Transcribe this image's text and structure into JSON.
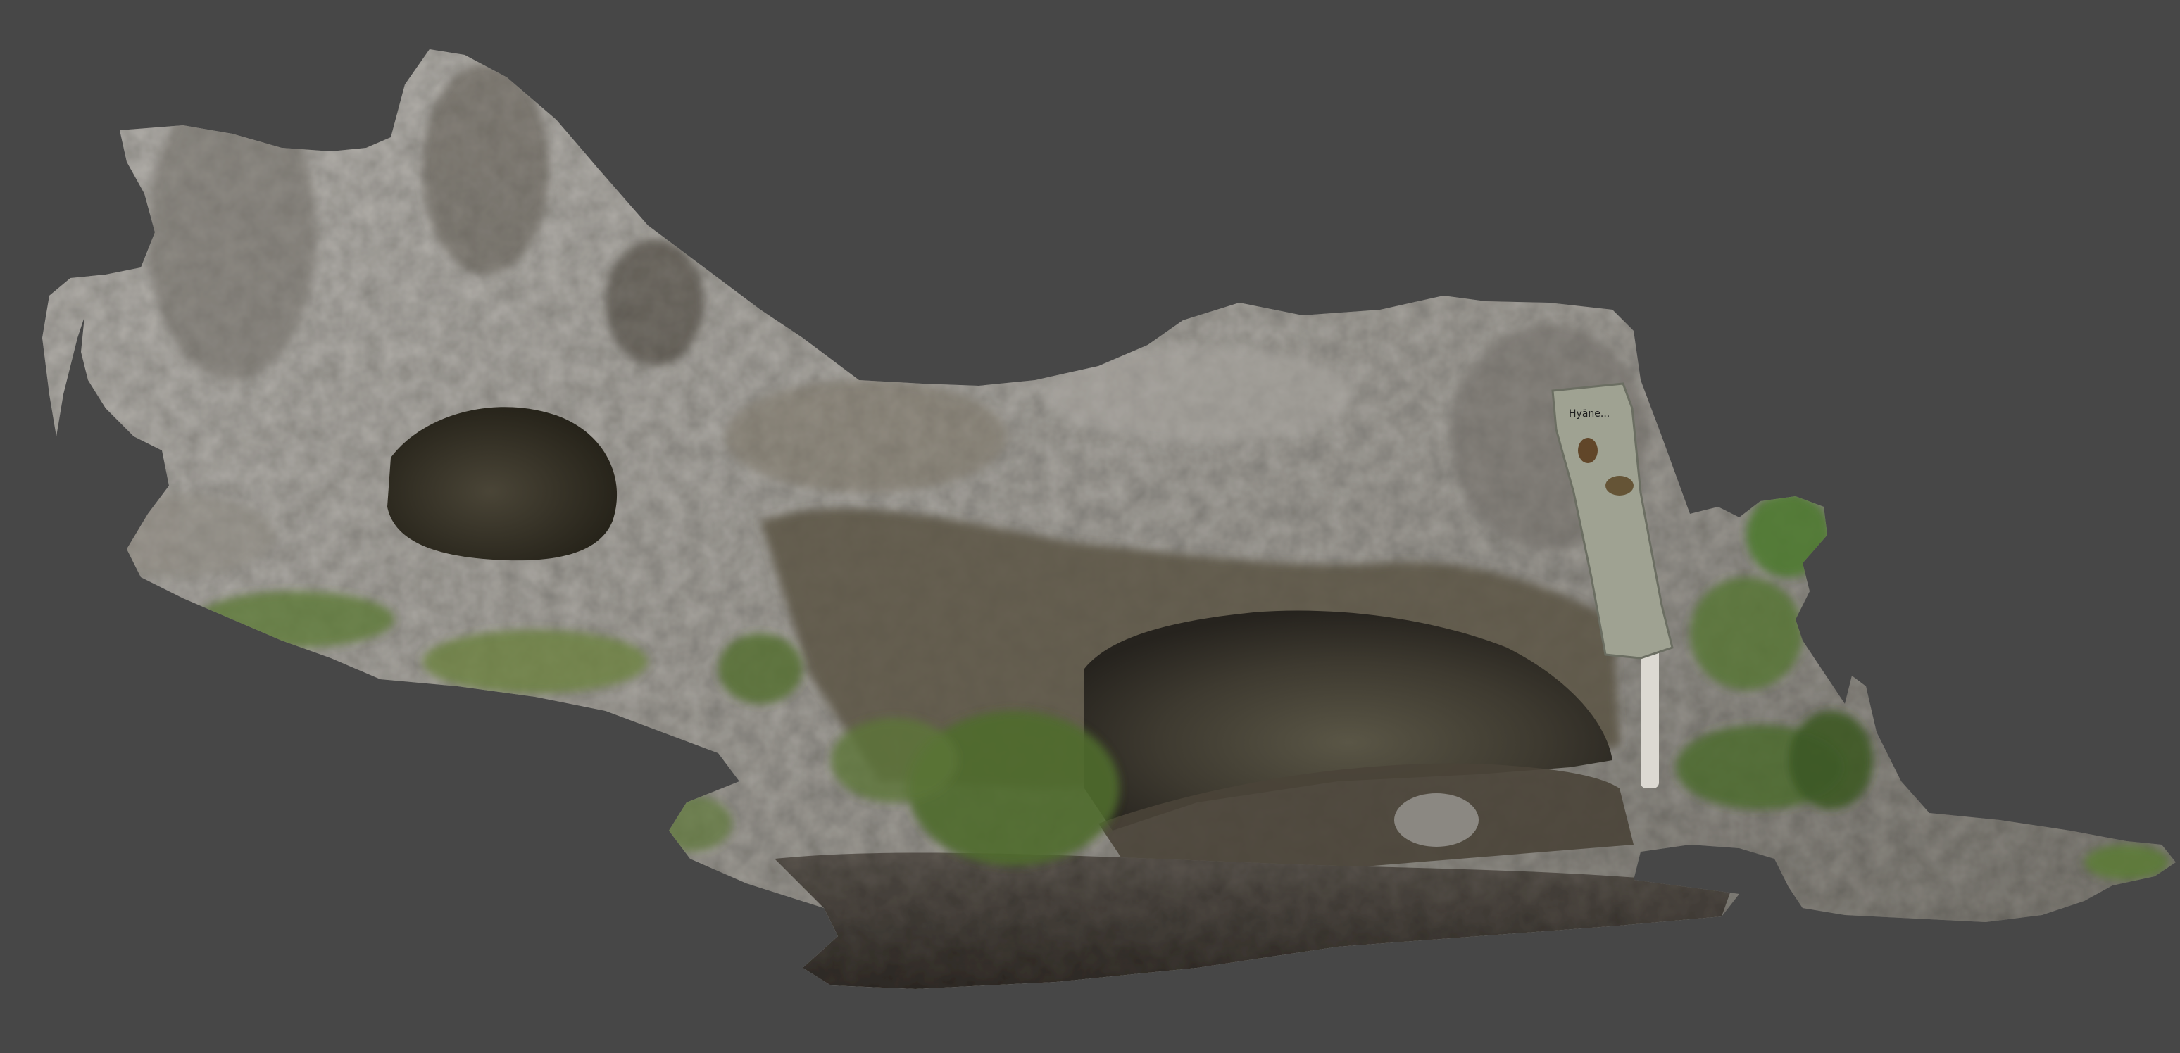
{
  "viewport": {
    "background_color": "#474747"
  },
  "model": {
    "subject": "photogrammetry-cave-mesh",
    "colors": {
      "rock_light": "#b9b6b1",
      "rock_mid": "#8f8d88",
      "rock_dark": "#5a5650",
      "interior_dark": "#2f2b24",
      "interior_mid": "#4b4536",
      "moss_green": "#5f7a3a",
      "moss_dark": "#3e5228",
      "floor_dark": "#3a3530",
      "sign_panel": "#a3a596",
      "sign_post": "#e0ddd6"
    },
    "sign": {
      "text": "Hyäne..."
    }
  }
}
